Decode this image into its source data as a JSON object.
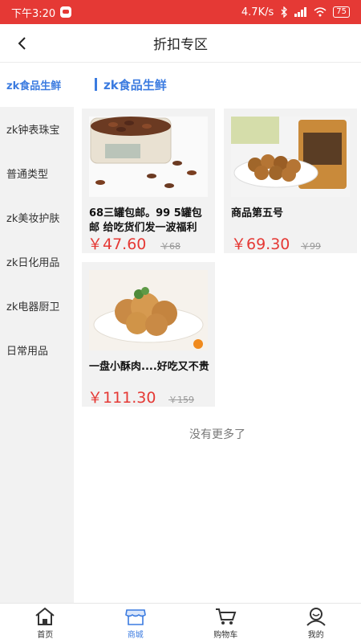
{
  "status_bar": {
    "time": "下午3:20",
    "net_speed": "4.7K/s",
    "battery": "75",
    "bg_color": "#e53935"
  },
  "header": {
    "title": "折扣专区",
    "back_icon": "chevron-left-icon"
  },
  "sidebar": {
    "items": [
      {
        "label": "zk食品生鲜",
        "active": true
      },
      {
        "label": "zk钟表珠宝"
      },
      {
        "label": "普通类型"
      },
      {
        "label": "zk美妆护肤"
      },
      {
        "label": "zk日化用品"
      },
      {
        "label": "zk电器厨卫"
      },
      {
        "label": "日常用品"
      }
    ]
  },
  "section": {
    "title": "zk食品生鲜",
    "accent": "#3b7be0"
  },
  "products": [
    {
      "name": "68三罐包邮。99 5罐包邮 给吃货们发一波福利",
      "price": "￥47.60",
      "original": "￥68"
    },
    {
      "name": "商品第五号",
      "price": "￥69.30",
      "original": "￥99"
    },
    {
      "name": "一盘小酥肉....好吃又不贵",
      "price": "￥111.30",
      "original": "￥159"
    }
  ],
  "list_end_text": "没有更多了",
  "tabbar": {
    "items": [
      {
        "label": "首页",
        "icon": "home-icon"
      },
      {
        "label": "商城",
        "icon": "shop-icon",
        "active": true
      },
      {
        "label": "购物车",
        "icon": "cart-icon"
      },
      {
        "label": "我的",
        "icon": "user-icon"
      }
    ]
  }
}
